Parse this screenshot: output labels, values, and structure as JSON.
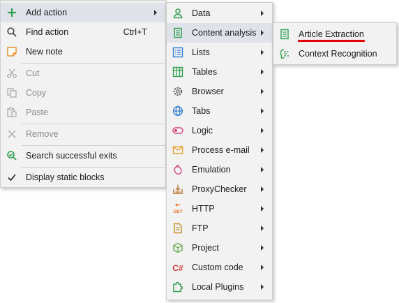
{
  "main_menu": {
    "add_action": "Add action",
    "find_action": "Find action",
    "find_action_shortcut": "Ctrl+T",
    "new_note": "New note",
    "cut": "Cut",
    "copy": "Copy",
    "paste": "Paste",
    "remove": "Remove",
    "search_successful_exits": "Search successful exits",
    "display_static_blocks": "Display static blocks"
  },
  "add_action_menu": {
    "items": [
      {
        "label": "Data",
        "icon": "user-icon"
      },
      {
        "label": "Content analysis",
        "icon": "document-icon"
      },
      {
        "label": "Lists",
        "icon": "list-icon"
      },
      {
        "label": "Tables",
        "icon": "table-icon"
      },
      {
        "label": "Browser",
        "icon": "gear-icon"
      },
      {
        "label": "Tabs",
        "icon": "globe-icon"
      },
      {
        "label": "Logic",
        "icon": "toggle-icon"
      },
      {
        "label": "Process e-mail",
        "icon": "envelope-icon"
      },
      {
        "label": "Emulation",
        "icon": "mouse-icon"
      },
      {
        "label": "ProxyChecker",
        "icon": "proxy-icon"
      },
      {
        "label": "HTTP",
        "icon": "get-request-icon"
      },
      {
        "label": "FTP",
        "icon": "ftp-file-icon"
      },
      {
        "label": "Project",
        "icon": "cube-icon"
      },
      {
        "label": "Custom code",
        "icon": "csharp-icon"
      },
      {
        "label": "Local Plugins",
        "icon": "puzzle-icon"
      }
    ]
  },
  "content_analysis_menu": {
    "article_extraction": "Article Extraction",
    "context_recognition": "Context Recognition"
  },
  "colors": {
    "menu_bg": "#f2f2f2",
    "highlight": "#dfe2e8",
    "accent_green": "#2e9e4f",
    "accent_blue": "#2b7bd6",
    "accent_orange": "#e8902a",
    "underline_red": "#e00000"
  }
}
